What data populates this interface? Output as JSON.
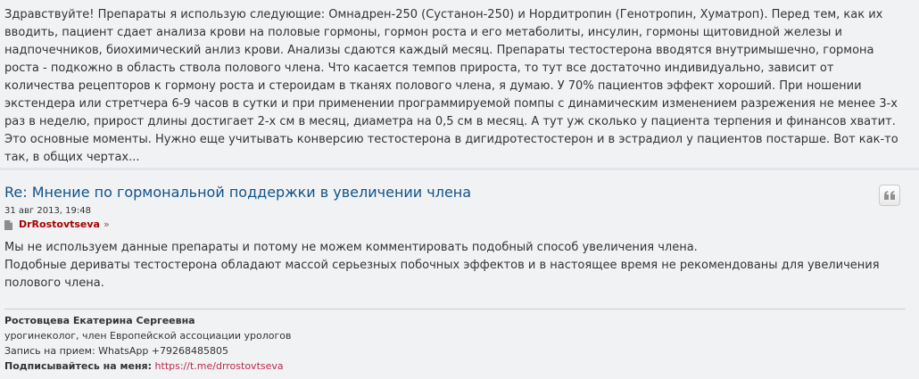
{
  "previous_post": {
    "text": "Здравствуйте! Препараты я использую следующие: Омнадрен-250 (Сустанон-250) и Нордитропин (Генотропин, Хуматроп). Перед тем, как их вводить, пациент сдает анализа крови на половые гормоны, гормон роста и его метаболиты, инсулин, гормоны щитовидной железы и надпочечников, биохимический анлиз крови. Анализы сдаются каждый месяц. Препараты тестостерона вводятся внутримышечно, гормона роста - подкожно в область ствола полового члена. Что касается темпов прироста, то тут все достаточно индивидуально, зависит от количества рецепторов к гормону роста и стероидам в тканях полового члена, я думаю. У 70% пациентов эффект хороший. При ношении экстендера или стретчера 6-9 часов в сутки и при применении программируемой помпы с динамическим изменением разрежения не менее 3-х раз в неделю, прирост длины достигает 2-х см в месяц, диаметра на 0,5 см в месяц. А тут уж сколько у пациента терпения и финансов хватит. Это основные моменты. Нужно еще учитывать конверсию тестостерона в дигидротестостерон и в эстрадиол у пациентов постарше. Вот как-то так, в общих чертах..."
  },
  "post": {
    "title": "Re: Мнение по гормональной поддержки в увеличении члена",
    "date": "31 авг 2013, 19:48",
    "author": "DrRostovtseva",
    "author_arrow": "»",
    "quote_icon": "quote-icon",
    "doc_icon": "post-document-icon",
    "body_lines": [
      "Мы не используем данные препараты и потому не можем комментировать подобный способ увеличения члена.",
      "Подобные дериваты тестостерона обладают массой серьезных побочных эффектов и в настоящее время не рекомендованы для увеличения полового члена."
    ],
    "signature": {
      "name": "Ростовцева Екатерина Сергеевна",
      "role": "урогинеколог, член Европейской ассоциации урологов",
      "appointment": "Запись на прием: WhatsApp +79268485805",
      "subscribe_label": "Подписывайтесь на меня:",
      "subscribe_link": "https://t.me/drrostovtseva"
    }
  },
  "colors": {
    "title": "#105289",
    "author": "#aa0000",
    "link": "#bc2a4d",
    "background": "#f1f2f4"
  }
}
